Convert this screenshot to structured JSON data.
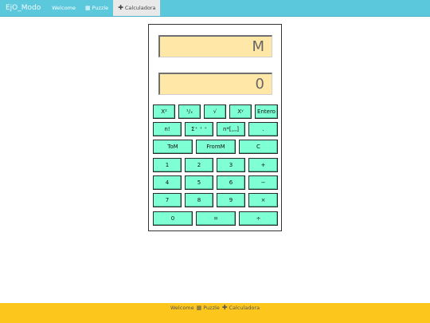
{
  "nav": {
    "brand": "EjO_Modo",
    "items": [
      {
        "label": "Welcome",
        "icon": ""
      },
      {
        "label": "Puzzle",
        "icon": "grid-icon"
      },
      {
        "label": "Calculadora",
        "icon": "plus-icon",
        "active": true
      }
    ]
  },
  "calculator": {
    "memory_display": "M",
    "main_display": "0",
    "buttons": {
      "x2": "X²",
      "inv": "¹/ₓ",
      "sqrt": "√",
      "xy": "Xʸ",
      "entero": "Entero",
      "fact": "n!",
      "sum": "Σ⁺ ⁺ ⁺",
      "nlist": "n*[,,,]",
      "dot": ".",
      "tom": "ToM",
      "fromm": "FromM",
      "clear": "C",
      "d1": "1",
      "d2": "2",
      "d3": "3",
      "plus": "+",
      "d4": "4",
      "d5": "5",
      "d6": "6",
      "minus": "−",
      "d7": "7",
      "d8": "8",
      "d9": "9",
      "times": "×",
      "d0": "0",
      "equals": "=",
      "divide": "÷"
    }
  },
  "footer": {
    "links": [
      {
        "label": "Welcome"
      },
      {
        "label": "Puzzle",
        "icon": "grid-icon"
      },
      {
        "label": "Calculadora",
        "icon": "plus-icon"
      }
    ]
  },
  "colors": {
    "navbar": "#5bc8dc",
    "footer": "#fdc61c",
    "display": "#ffe7a8",
    "button": "#7fffd4"
  }
}
